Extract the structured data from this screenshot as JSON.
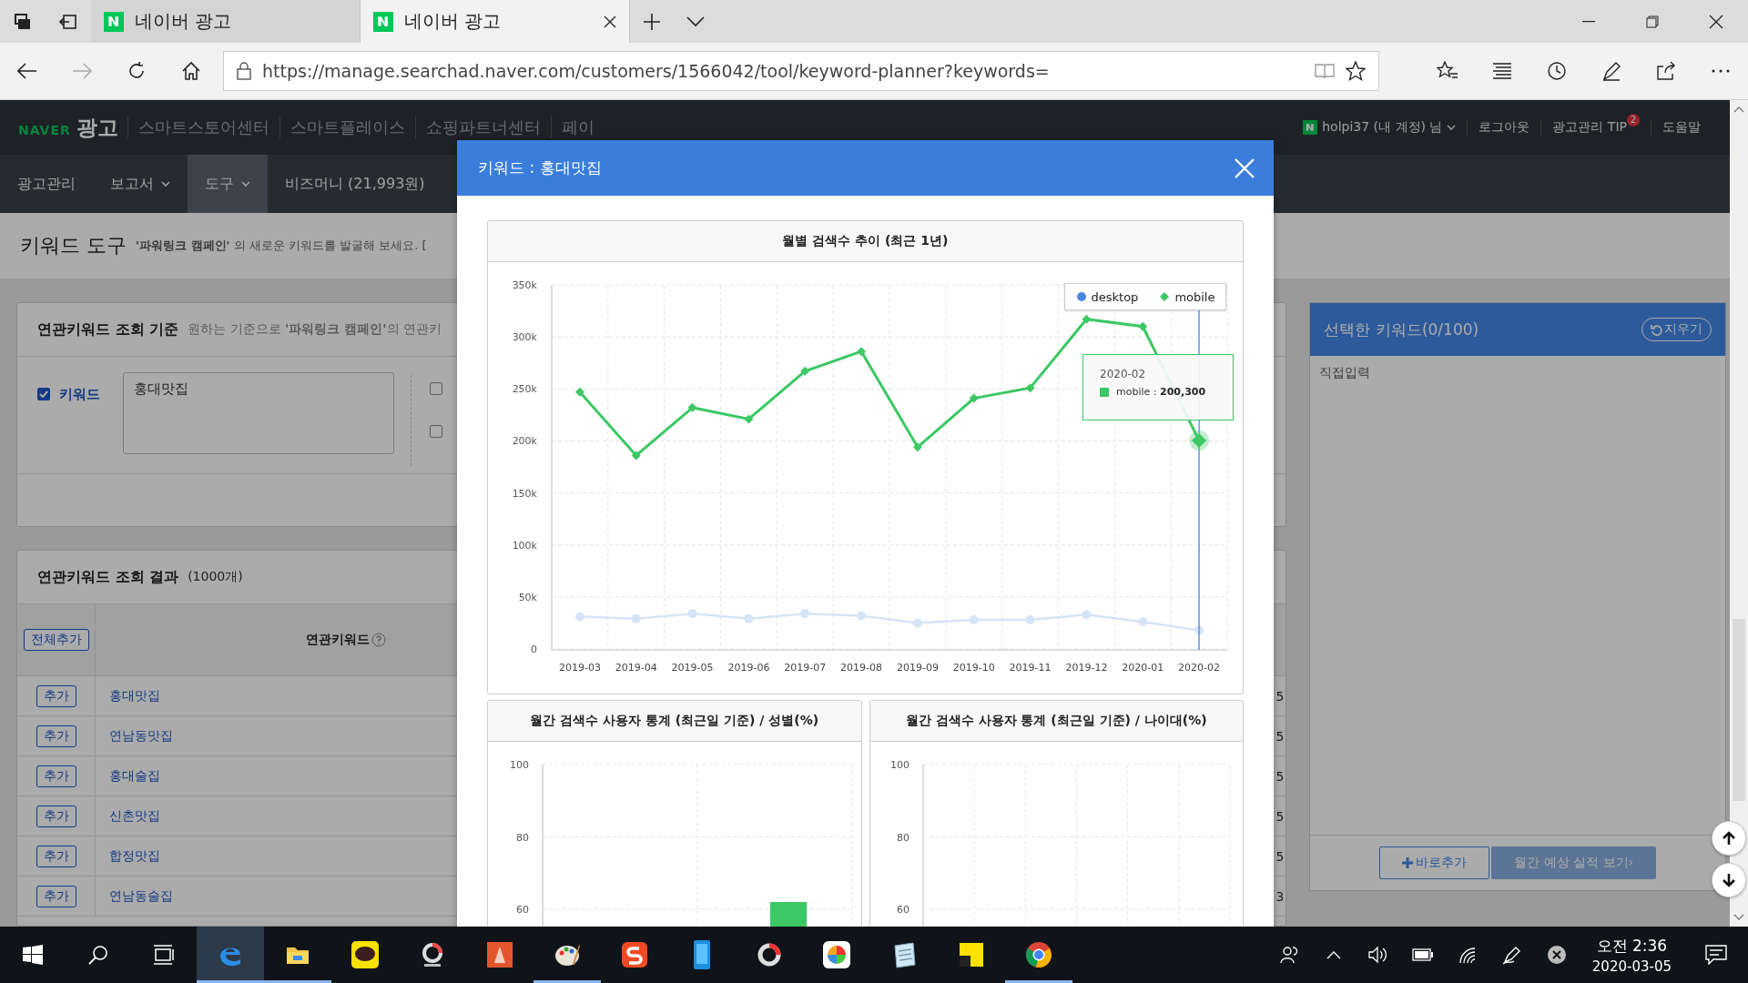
{
  "browser": {
    "tabs": [
      {
        "title": "네이버 광고",
        "selected": false
      },
      {
        "title": "네이버 광고",
        "selected": true
      }
    ],
    "url": "https://manage.searchad.naver.com/customers/1566042/tool/keyword-planner?keywords="
  },
  "top_nav": {
    "logo_word": "NAVER",
    "logo_label": "광고",
    "links": [
      "스마트스토어센터",
      "스마트플레이스",
      "쇼핑파트너센터",
      "페이"
    ],
    "user": "holpi37 (내 계정) 님",
    "logout": "로그아웃",
    "tip": "광고관리 TIP",
    "tip_badge": "2",
    "help": "도움말"
  },
  "menu": [
    {
      "label": "광고관리",
      "dropdown": false,
      "selected": false
    },
    {
      "label": "보고서",
      "dropdown": true,
      "selected": false
    },
    {
      "label": "도구",
      "dropdown": true,
      "selected": true
    },
    {
      "label": "비즈머니 (21,993원)",
      "dropdown": false,
      "selected": false
    }
  ],
  "page": {
    "title": "키워드 도구",
    "subtitle": "**'파워링크 캠페인'** 의 새로운 키워드를 발굴해 보세요. ["
  },
  "criteria": {
    "title": "연관키워드 조회 기준",
    "description": "원하는 기준으로 **'파워링크 캠페인'**의 연관키",
    "keyword_option": {
      "label": "키워드",
      "checked": true,
      "value": "홍대맛집"
    },
    "side_options": [
      {
        "checked": false
      },
      {
        "checked": false
      }
    ]
  },
  "results": {
    "title": "연관키워드 조회 결과",
    "count": "(1000개)",
    "add_all": "전체추가",
    "column": "연관키워드",
    "rows": [
      {
        "action": "추가",
        "keyword": "홍대맛집",
        "column_last": "5"
      },
      {
        "action": "추가",
        "keyword": "연남동맛집",
        "column_last": "5"
      },
      {
        "action": "추가",
        "keyword": "홍대술집",
        "column_last": "5"
      },
      {
        "action": "추가",
        "keyword": "신촌맛집",
        "column_last": "5"
      },
      {
        "action": "추가",
        "keyword": "합정맛집",
        "column_last": "5"
      },
      {
        "action": "추가",
        "keyword": "연남동술집",
        "column_last": "3"
      }
    ]
  },
  "selected_panel": {
    "title": "선택한 키워드(0/100)",
    "clear": "지우기",
    "placeholder": "직접입력",
    "add": "바로추가",
    "forecast": "월간 예상 실적 보기›"
  },
  "modal": {
    "title": "키워드 : 홍대맛집",
    "trend": {
      "chart_data": {
        "type": "line",
        "title": "월별 검색수 추이 (최근 1년)",
        "grid": true,
        "legend": true,
        "ref_lines": [
          {
            "axis": "x",
            "value": "2020-02",
            "color": "#3b7ddb"
          }
        ],
        "categories": [
          "2019-03",
          "2019-04",
          "2019-05",
          "2019-06",
          "2019-07",
          "2019-08",
          "2019-09",
          "2019-10",
          "2019-11",
          "2019-12",
          "2020-01",
          "2020-02"
        ],
        "ylim": [
          0,
          350000
        ],
        "yticks": [
          0,
          {
            "value": 50000,
            "label": "50k"
          },
          {
            "value": 100000,
            "label": "100k"
          },
          {
            "value": 150000,
            "label": "150k"
          },
          {
            "value": 200000,
            "label": "200k"
          },
          {
            "value": 250000,
            "label": "250k"
          },
          {
            "value": 300000,
            "label": "300k"
          },
          {
            "value": 350000,
            "label": "350k"
          }
        ],
        "series": [
          {
            "name": "desktop",
            "color": "#4a86e0",
            "marker": "circle",
            "values": [
              31000,
              29000,
              34000,
              29000,
              34000,
              32000,
              25000,
              28000,
              28000,
              33000,
              26000,
              18000
            ]
          },
          {
            "name": "mobile",
            "color": "#3cc864",
            "marker": "diamond",
            "values": [
              247000,
              186000,
              232000,
              221000,
              267000,
              286000,
              194000,
              241000,
              251000,
              317000,
              310000,
              200300
            ]
          }
        ]
      },
      "tooltip": {
        "title": "2020-02",
        "text": "mobile : **200,300**"
      }
    },
    "gender": {
      "chart_data": {
        "type": "bar",
        "title": "월간 검색수 사용자 통계 (최근일 기준) / 성별(%)",
        "grid": true,
        "ylim": [
          0,
          100
        ],
        "yticks": [
          60,
          80,
          100
        ],
        "values": [
          null,
          62
        ]
      }
    },
    "age": {
      "title": "월간 검색수 사용자 통계 (최근일 기준) / 나이대(%)",
      "axis_labels": [
        "100",
        "80",
        "60"
      ]
    }
  },
  "taskbar": {
    "apps": [
      {
        "kind": "edge",
        "running": true,
        "selected": true
      },
      {
        "kind": "explorer",
        "running": true,
        "selected": false
      },
      {
        "kind": "talk",
        "running": false,
        "selected": false
      },
      {
        "kind": "ring",
        "running": false,
        "selected": false
      },
      {
        "kind": "pen",
        "running": false,
        "selected": false
      },
      {
        "kind": "paint",
        "running": true,
        "selected": false
      },
      {
        "kind": "s",
        "running": false,
        "selected": false
      },
      {
        "kind": "phone",
        "running": false,
        "selected": false
      },
      {
        "kind": "ring2",
        "running": false,
        "selected": false
      },
      {
        "kind": "color",
        "running": false,
        "selected": false
      },
      {
        "kind": "notepad",
        "running": false,
        "selected": false
      },
      {
        "kind": "sticky",
        "running": false,
        "selected": false
      },
      {
        "kind": "chrome",
        "running": true,
        "selected": false
      }
    ],
    "time": "오전 2:36",
    "date": "2020-03-05"
  }
}
